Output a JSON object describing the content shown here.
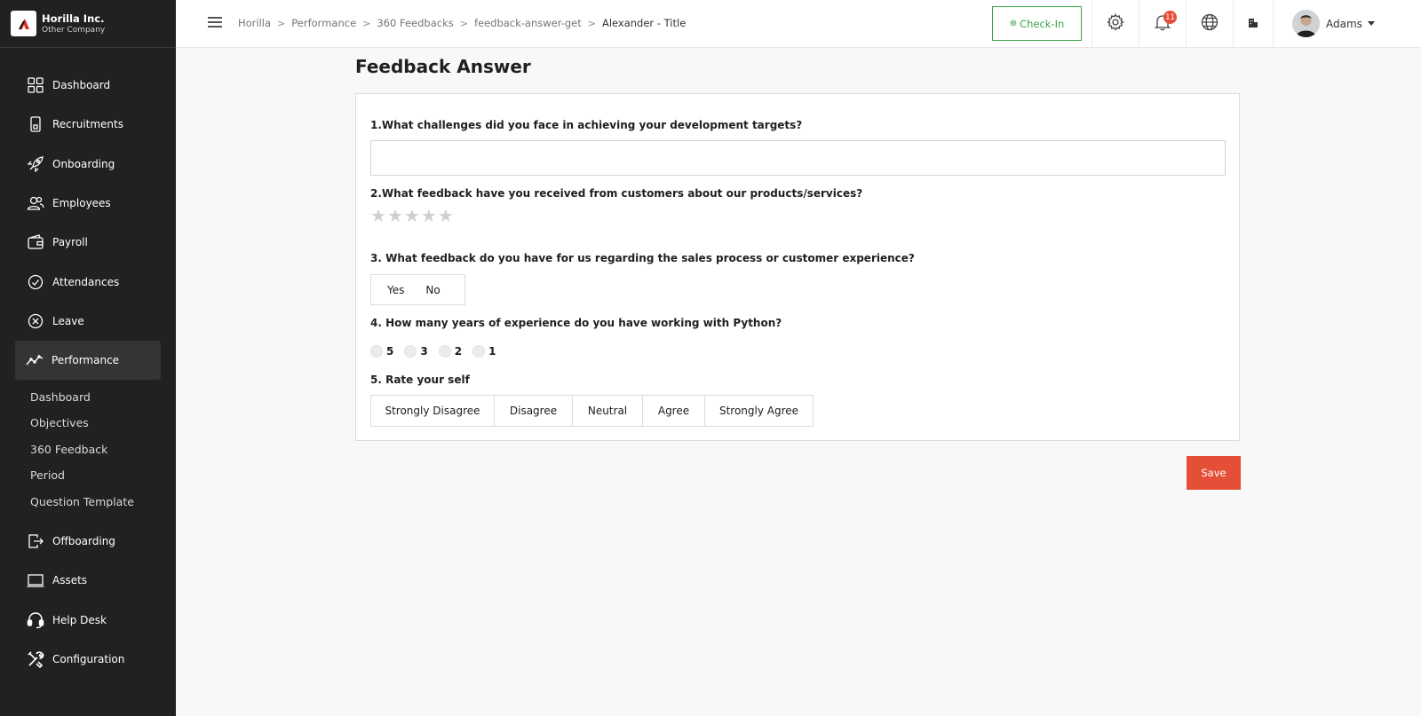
{
  "brand": {
    "name": "Horilla Inc.",
    "subtitle": "Other Company"
  },
  "sidebar": {
    "items": [
      {
        "label": "Dashboard",
        "icon": "grid-icon"
      },
      {
        "label": "Recruitments",
        "icon": "phone-icon"
      },
      {
        "label": "Onboarding",
        "icon": "rocket-icon"
      },
      {
        "label": "Employees",
        "icon": "people-icon"
      },
      {
        "label": "Payroll",
        "icon": "wallet-icon"
      },
      {
        "label": "Attendances",
        "icon": "check-circle-icon"
      },
      {
        "label": "Leave",
        "icon": "x-circle-icon"
      },
      {
        "label": "Performance",
        "icon": "trend-icon",
        "active": true
      },
      {
        "label": "Offboarding",
        "icon": "exit-icon"
      },
      {
        "label": "Assets",
        "icon": "laptop-icon"
      },
      {
        "label": "Help Desk",
        "icon": "headset-icon"
      },
      {
        "label": "Configuration",
        "icon": "tools-icon"
      }
    ],
    "performance_sub": [
      "Dashboard",
      "Objectives",
      "360 Feedback",
      "Period",
      "Question Template"
    ]
  },
  "header": {
    "breadcrumb": [
      "Horilla",
      "Performance",
      "360 Feedbacks",
      "feedback-answer-get",
      "Alexander - Title"
    ],
    "checkin_label": "Check-In",
    "notification_count": "11",
    "user_name": "Adams"
  },
  "main": {
    "title": "Feedback Answer",
    "questions": [
      {
        "text": "1.What challenges did you face in achieving your development targets?"
      },
      {
        "text": "2.What feedback have you received from customers about our products/services?"
      },
      {
        "text": "3. What feedback do you have for us regarding the sales process or customer experience?"
      },
      {
        "text": "4. How many years of experience do you have working with Python?"
      },
      {
        "text": "5. Rate your self"
      }
    ],
    "q1_input_value": "",
    "yes_label": "Yes",
    "no_label": "No",
    "radio_options": [
      "5",
      "3",
      "2",
      "1"
    ],
    "likert_options": [
      "Strongly Disagree",
      "Disagree",
      "Neutral",
      "Agree",
      "Strongly Agree"
    ],
    "save_label": "Save"
  },
  "colors": {
    "accent": "#e54f38",
    "checkin": "#3aa24a",
    "sidebar": "#212121"
  }
}
